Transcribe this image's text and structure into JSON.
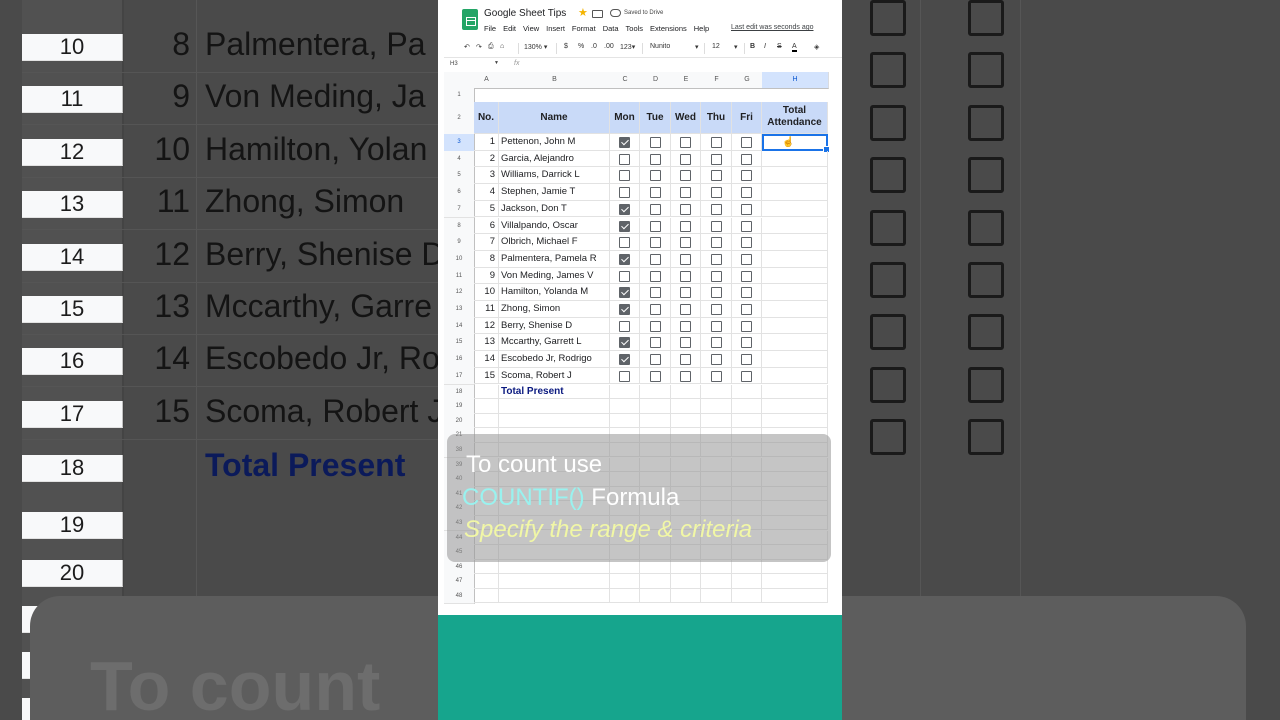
{
  "app": {
    "doc_title": "Google Sheet Tips",
    "saved_status": "Saved to Drive",
    "last_edit": "Last edit was seconds ago",
    "menu": [
      "File",
      "Edit",
      "View",
      "Insert",
      "Format",
      "Data",
      "Tools",
      "Extensions",
      "Help"
    ]
  },
  "toolbar": {
    "zoom": "130%",
    "currency": "$",
    "percent": "%",
    "dec_less": ".0",
    "dec_more": ".00",
    "number_format": "123",
    "font": "Nunito",
    "font_size": "12",
    "bold": "B",
    "italic": "I",
    "strike": "S",
    "text_color": "A"
  },
  "formula_bar": {
    "cell_ref": "H3",
    "fx": "fx"
  },
  "columns": [
    "A",
    "B",
    "C",
    "D",
    "E",
    "F",
    "G",
    "H"
  ],
  "headers": {
    "no": "No.",
    "name": "Name",
    "days": [
      "Mon",
      "Tue",
      "Wed",
      "Thu",
      "Fri"
    ],
    "total_1": "Total",
    "total_2": "Attendance"
  },
  "rows": [
    {
      "row": "3",
      "no": "1",
      "name": "Pettenon,  John M",
      "checks": [
        true,
        false,
        false,
        false,
        false
      ]
    },
    {
      "row": "4",
      "no": "2",
      "name": "Garcia,  Alejandro",
      "checks": [
        false,
        false,
        false,
        false,
        false
      ]
    },
    {
      "row": "5",
      "no": "3",
      "name": "Williams,  Darrick L",
      "checks": [
        false,
        false,
        false,
        false,
        false
      ]
    },
    {
      "row": "6",
      "no": "4",
      "name": "Stephen,  Jamie T",
      "checks": [
        false,
        false,
        false,
        false,
        false
      ]
    },
    {
      "row": "7",
      "no": "5",
      "name": "Jackson,  Don T",
      "checks": [
        true,
        false,
        false,
        false,
        false
      ]
    },
    {
      "row": "8",
      "no": "6",
      "name": "Villalpando,  Oscar",
      "checks": [
        true,
        false,
        false,
        false,
        false
      ]
    },
    {
      "row": "9",
      "no": "7",
      "name": "Olbrich,  Michael F",
      "checks": [
        false,
        false,
        false,
        false,
        false
      ]
    },
    {
      "row": "10",
      "no": "8",
      "name": "Palmentera,  Pamela R",
      "checks": [
        true,
        false,
        false,
        false,
        false
      ]
    },
    {
      "row": "11",
      "no": "9",
      "name": "Von Meding,  James V",
      "checks": [
        false,
        false,
        false,
        false,
        false
      ]
    },
    {
      "row": "12",
      "no": "10",
      "name": "Hamilton,  Yolanda M",
      "checks": [
        true,
        false,
        false,
        false,
        false
      ]
    },
    {
      "row": "13",
      "no": "11",
      "name": "Zhong,  Simon",
      "checks": [
        true,
        false,
        false,
        false,
        false
      ]
    },
    {
      "row": "14",
      "no": "12",
      "name": "Berry,  Shenise D",
      "checks": [
        false,
        false,
        false,
        false,
        false
      ]
    },
    {
      "row": "15",
      "no": "13",
      "name": "Mccarthy,  Garrett L",
      "checks": [
        true,
        false,
        false,
        false,
        false
      ]
    },
    {
      "row": "16",
      "no": "14",
      "name": "Escobedo Jr,  Rodrigo",
      "checks": [
        true,
        false,
        false,
        false,
        false
      ]
    },
    {
      "row": "17",
      "no": "15",
      "name": "Scoma,  Robert J",
      "checks": [
        false,
        false,
        false,
        false,
        false
      ]
    }
  ],
  "total_present_label": "Total Present",
  "extra_rows": [
    "18",
    "19",
    "20",
    "21",
    "38",
    "39",
    "40",
    "41",
    "42",
    "43",
    "44",
    "45",
    "46",
    "47",
    "48"
  ],
  "first_rows": [
    "1",
    "2"
  ],
  "caption": {
    "line1": "To count use",
    "line2_highlight": "COUNTIF()",
    "line2_rest": " Formula",
    "line3": "Specify the range & criteria"
  },
  "background": {
    "rows": [
      {
        "row": "10",
        "no": "8",
        "name": "Palmentera,  Pa"
      },
      {
        "row": "11",
        "no": "9",
        "name": "Von Meding,  Ja"
      },
      {
        "row": "12",
        "no": "10",
        "name": "Hamilton,  Yolan"
      },
      {
        "row": "13",
        "no": "11",
        "name": "Zhong,  Simon"
      },
      {
        "row": "14",
        "no": "12",
        "name": "Berry,  Shenise D"
      },
      {
        "row": "15",
        "no": "13",
        "name": "Mccarthy,  Garre"
      },
      {
        "row": "16",
        "no": "14",
        "name": "Escobedo Jr,  Ro"
      },
      {
        "row": "17",
        "no": "15",
        "name": "Scoma,  Robert J"
      }
    ],
    "total_row": "18",
    "total_label": "Total Present",
    "lower_rows": [
      "19",
      "20",
      "21",
      "38",
      "39"
    ],
    "big_text": "To count"
  },
  "colors": {
    "header_fill": "#c9daf8",
    "checkbox": "#5f6368",
    "active_border": "#1a73e8",
    "caption_highlight": "#99f2ef",
    "caption_italic": "#f1f7a6",
    "teal_band": "#16a58d",
    "sheets_green": "#23a566"
  }
}
